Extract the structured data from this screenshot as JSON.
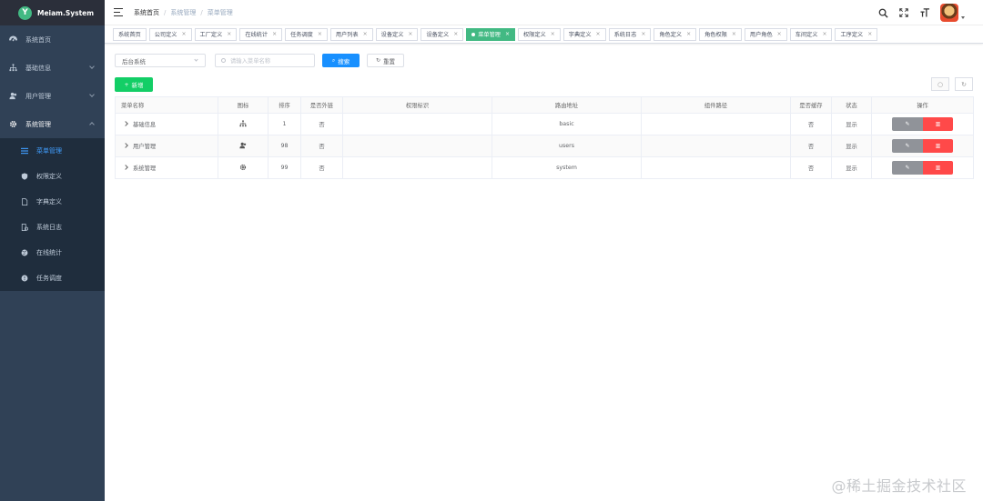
{
  "app": {
    "logo_letter": "Y",
    "title": "Meiam.System"
  },
  "sidebar": {
    "items": [
      {
        "label": "系统首页",
        "icon": "dashboard-icon"
      },
      {
        "label": "基础信息",
        "icon": "sitemap-icon"
      },
      {
        "label": "用户管理",
        "icon": "users-icon"
      },
      {
        "label": "系统管理",
        "icon": "gear-icon"
      }
    ],
    "submenu": [
      {
        "label": "菜单管理",
        "icon": "list-icon"
      },
      {
        "label": "权限定义",
        "icon": "shield-icon"
      },
      {
        "label": "字典定义",
        "icon": "document-icon"
      },
      {
        "label": "系统日志",
        "icon": "log-icon"
      },
      {
        "label": "在线统计",
        "icon": "globe-icon"
      },
      {
        "label": "任务调度",
        "icon": "clock-icon"
      }
    ]
  },
  "header": {
    "breadcrumb": [
      "系统首页",
      "系统管理",
      "菜单管理"
    ],
    "icons": [
      "search-icon",
      "fullscreen-icon",
      "font-size-icon"
    ]
  },
  "tags": [
    "系统首页",
    "公司定义",
    "工厂定义",
    "在线统计",
    "任务调度",
    "用户列表",
    "设备定义",
    "设备定义",
    "菜单管理",
    "权限定义",
    "字典定义",
    "系统日志",
    "角色定义",
    "角色权限",
    "用户角色",
    "车间定义",
    "工序定义"
  ],
  "filter": {
    "system_value": "后台系统",
    "search_placeholder": "请输入菜单名称",
    "search_label": "搜索",
    "reset_label": "重置",
    "add_label": "新增"
  },
  "table": {
    "columns": [
      "菜单名称",
      "图标",
      "排序",
      "是否外链",
      "权限标识",
      "路由地址",
      "组件路径",
      "是否缓存",
      "状态",
      "操作"
    ],
    "rows": [
      {
        "name": "基础信息",
        "icon": "sitemap-icon",
        "sort": "1",
        "external": "否",
        "perm": "",
        "route": "basic",
        "component": "",
        "cache": "否",
        "status": "显示"
      },
      {
        "name": "用户管理",
        "icon": "users-icon",
        "sort": "98",
        "external": "否",
        "perm": "",
        "route": "users",
        "component": "",
        "cache": "否",
        "status": "显示"
      },
      {
        "name": "系统管理",
        "icon": "gear-icon",
        "sort": "99",
        "external": "否",
        "perm": "",
        "route": "system",
        "component": "",
        "cache": "否",
        "status": "显示"
      }
    ]
  },
  "watermark": "@稀土掘金技术社区"
}
